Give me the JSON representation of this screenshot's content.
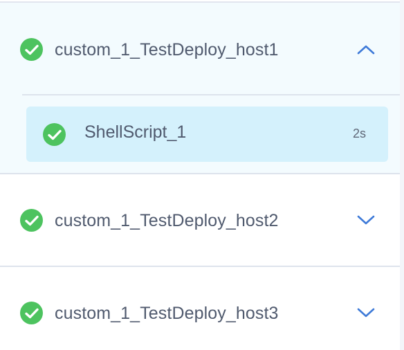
{
  "groups": [
    {
      "label": "custom_1_TestDeploy_host1",
      "status_icon": "check-circle-icon",
      "toggle_icon": "chevron-up-icon",
      "expanded": true,
      "steps": [
        {
          "label": "ShellScript_1",
          "duration": "2s",
          "status_icon": "check-circle-icon"
        }
      ]
    },
    {
      "label": "custom_1_TestDeploy_host2",
      "status_icon": "check-circle-icon",
      "toggle_icon": "chevron-down-icon",
      "expanded": false
    },
    {
      "label": "custom_1_TestDeploy_host3",
      "status_icon": "check-circle-icon",
      "toggle_icon": "chevron-down-icon",
      "expanded": false
    }
  ],
  "colors": {
    "success": "#4dc35f",
    "accent": "#3e7ad8",
    "text": "#505a6e",
    "expanded_bg": "#f3fbfe",
    "step_bg": "#d4f1fc"
  }
}
